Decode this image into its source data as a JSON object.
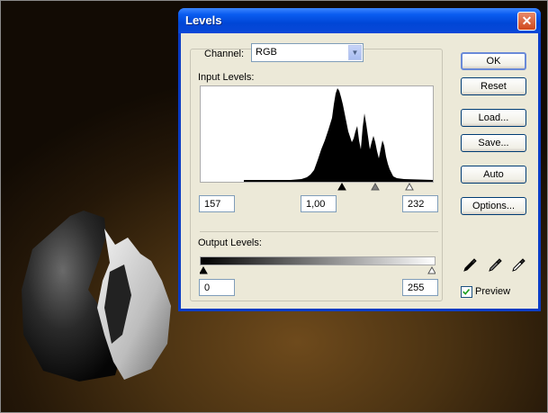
{
  "dialog": {
    "title": "Levels",
    "close_symbol": "✕"
  },
  "channel": {
    "label": "Channel:",
    "value": "RGB"
  },
  "input_levels": {
    "label": "Input Levels:",
    "black": "157",
    "gamma": "1,00",
    "white": "232"
  },
  "output_levels": {
    "label": "Output Levels:",
    "black": "0",
    "white": "255"
  },
  "buttons": {
    "ok": "OK",
    "reset": "Reset",
    "load": "Load...",
    "save": "Save...",
    "auto": "Auto",
    "options": "Options..."
  },
  "preview": {
    "label": "Preview",
    "checked": true
  },
  "icons": {
    "black_eyedropper": "eyedropper-black-icon",
    "gray_eyedropper": "eyedropper-gray-icon",
    "white_eyedropper": "eyedropper-white-icon"
  },
  "colors": {
    "titlebar": "#0a5cf0",
    "dialog_bg": "#ece9d8",
    "close_button": "#d0481c"
  }
}
